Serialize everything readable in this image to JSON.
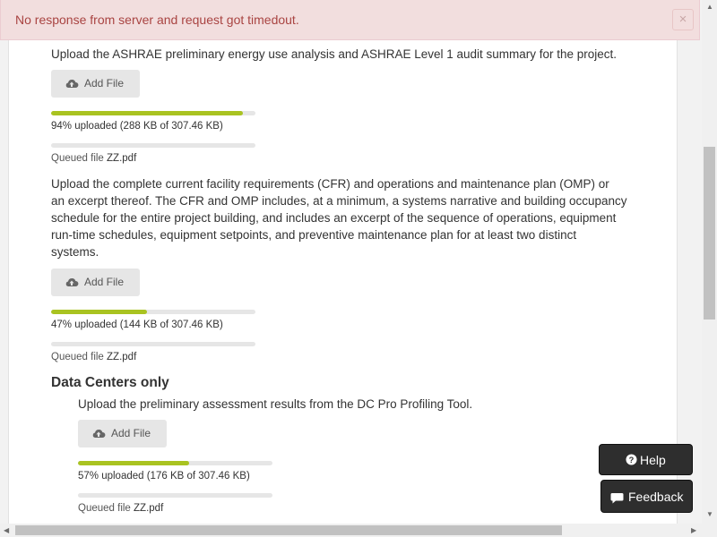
{
  "alert": {
    "message": "No response from server and request got timedout.",
    "close_glyph": "×"
  },
  "sections": [
    {
      "description": "Upload the ASHRAE preliminary energy use analysis and ASHRAE Level 1 audit summary for the project.",
      "add_label": "Add File",
      "progress_fraction": 0.94,
      "progress_text": "94% uploaded (288 KB of 307.46 KB)",
      "queued_label": "Queued file",
      "queued_file": "ZZ.pdf"
    },
    {
      "description_lines": [
        "Upload the complete current facility requirements (CFR) and operations and maintenance plan (OMP) or",
        "an excerpt thereof. The CFR and OMP includes, at a minimum, a systems narrative and building occupancy",
        "schedule for the entire project building, and includes an excerpt of the sequence of operations, equipment",
        "run-time schedules, equipment setpoints, and preventive maintenance plan for at least two distinct",
        "systems."
      ],
      "add_label": "Add File",
      "progress_fraction": 0.47,
      "progress_text": "47% uploaded (144 KB of 307.46 KB)",
      "queued_label": "Queued file",
      "queued_file": "ZZ.pdf"
    }
  ],
  "data_centers": {
    "title": "Data Centers only",
    "description": "Upload the preliminary assessment results from the DC Pro Profiling Tool.",
    "add_label": "Add File",
    "progress_fraction": 0.57,
    "progress_text": "57% uploaded (176 KB of 307.46 KB)",
    "queued_label": "Queued file",
    "queued_file": "ZZ.pdf"
  },
  "floating": {
    "help_label": "Help",
    "feedback_label": "Feedback"
  },
  "icons": {
    "upload": "cloud-upload-icon",
    "help": "question-circle-icon",
    "feedback": "comment-icon"
  },
  "colors": {
    "progress_fill": "#a9c321",
    "alert_bg": "#f2dede",
    "alert_text": "#a94442"
  }
}
